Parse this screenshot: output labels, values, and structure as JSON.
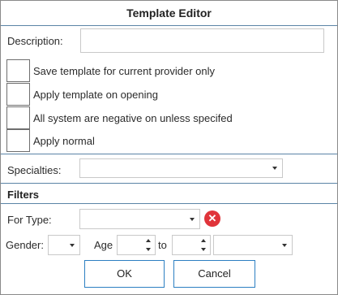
{
  "dialog": {
    "title": "Template Editor"
  },
  "description": {
    "label": "Description:",
    "value": ""
  },
  "options": [
    {
      "label": "Save template for current provider only",
      "checked": false
    },
    {
      "label": "Apply template on opening",
      "checked": false
    },
    {
      "label": "All system are negative on unless specifed",
      "checked": false
    },
    {
      "label": "Apply normal",
      "checked": false
    }
  ],
  "specialties": {
    "label": "Specialties:",
    "value": ""
  },
  "filters": {
    "heading": "Filters",
    "for_type_label": "For Type:",
    "for_type_value": "",
    "gender_label": "Gender:",
    "gender_value": "",
    "age_label": "Age",
    "age_from_value": "",
    "to_label": "to",
    "age_to_value": "",
    "age_unit_value": ""
  },
  "buttons": {
    "ok_label": "OK",
    "cancel_label": "Cancel"
  },
  "icons": {
    "clear": "clear-circle-icon",
    "dropdown": "chevron-down-icon"
  },
  "colors": {
    "divider": "#5b84a6",
    "button_border": "#2c7fc2",
    "clear_icon": "#e0343a"
  }
}
